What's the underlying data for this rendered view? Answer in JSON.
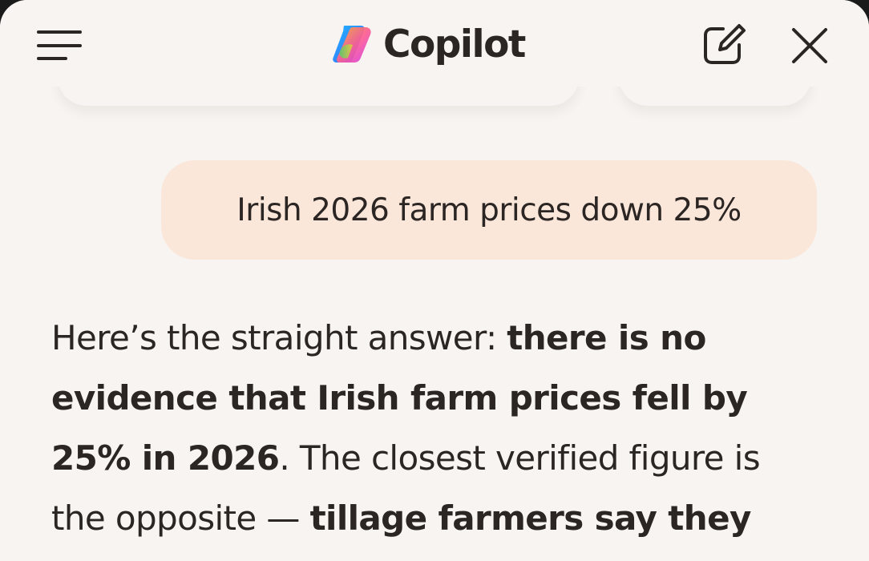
{
  "header": {
    "title": "Copilot",
    "icons": {
      "menu": "hamburger-menu-icon",
      "logo": "copilot-logo-icon",
      "new_chat": "new-chat-edit-icon",
      "close": "close-icon"
    }
  },
  "conversation": {
    "user_message": "Irish 2026 farm prices down 25%",
    "assistant_message": {
      "segments": [
        {
          "text": "Here’s the straight answer: ",
          "bold": false
        },
        {
          "text": "there is no evidence that Irish farm prices fell by 25% in 2026",
          "bold": true
        },
        {
          "text": ". The closest verified figure is the opposite — ",
          "bold": false
        },
        {
          "text": "tillage farmers say they",
          "bold": true
        }
      ]
    }
  },
  "colors": {
    "background": "#f7f4f1",
    "text": "#2b2523",
    "user_bubble": "#fbe7da"
  }
}
